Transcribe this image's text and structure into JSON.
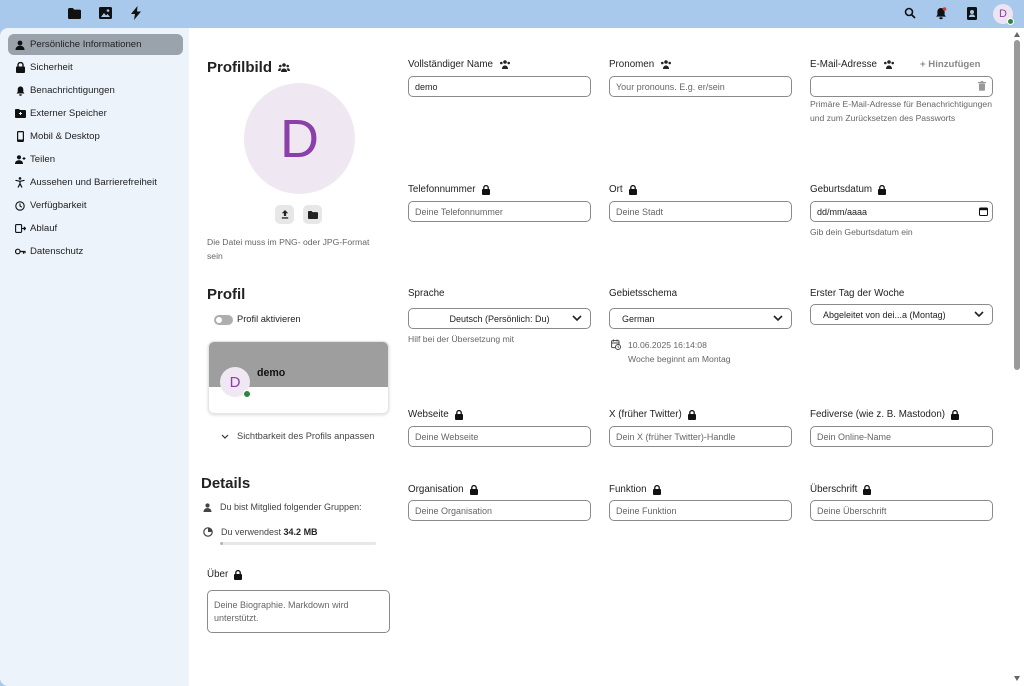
{
  "topbar": {
    "apps": [
      {
        "name": "files-icon"
      },
      {
        "name": "photos-icon"
      },
      {
        "name": "activity-icon"
      }
    ],
    "right_icons": [
      "search-icon",
      "notifications-icon",
      "contacts-icon"
    ],
    "avatar_letter": "D"
  },
  "sidebar": {
    "items": [
      {
        "label": "Persönliche Informationen",
        "icon": "user-icon",
        "active": true
      },
      {
        "label": "Sicherheit",
        "icon": "lock-icon"
      },
      {
        "label": "Benachrichtigungen",
        "icon": "bell-icon"
      },
      {
        "label": "Externer Speicher",
        "icon": "external-storage-icon"
      },
      {
        "label": "Mobil & Desktop",
        "icon": "phone-icon"
      },
      {
        "label": "Teilen",
        "icon": "share-icon"
      },
      {
        "label": "Aussehen und Barrierefreiheit",
        "icon": "accessibility-icon"
      },
      {
        "label": "Verfügbarkeit",
        "icon": "clock-icon"
      },
      {
        "label": "Ablauf",
        "icon": "flow-icon"
      },
      {
        "label": "Datenschutz",
        "icon": "key-icon"
      }
    ]
  },
  "profile_picture": {
    "title": "Profilbild",
    "letter": "D",
    "hint": "Die Datei muss im PNG- oder JPG-Format sein"
  },
  "profile": {
    "title": "Profil",
    "toggle_label": "Profil aktivieren",
    "card_name": "demo",
    "card_letter": "D",
    "visibility_label": "Sichtbarkeit des Profils anpassen"
  },
  "details": {
    "title": "Details",
    "groups_label": "Du bist Mitglied folgender Gruppen:",
    "quota_prefix": "Du verwendest",
    "quota_value": "34.2 MB",
    "quota_fraction": 0.02
  },
  "about": {
    "label": "Über",
    "placeholder": "Deine Biographie. Markdown wird unterstützt."
  },
  "fields": {
    "full_name": {
      "label": "Vollständiger Name",
      "value": "demo"
    },
    "pronouns": {
      "label": "Pronomen",
      "placeholder": "Your pronouns. E.g. er/sein"
    },
    "email": {
      "label": "E-Mail-Adresse",
      "add_label": "+ Hinzufügen",
      "hint": "Primäre E-Mail-Adresse für Benachrichtigungen und zum Zurücksetzen des Passworts"
    },
    "phone": {
      "label": "Telefonnummer",
      "placeholder": "Deine Telefonnummer"
    },
    "location": {
      "label": "Ort",
      "placeholder": "Deine Stadt"
    },
    "birthdate": {
      "label": "Geburtsdatum",
      "placeholder": "dd/mm/aaaa",
      "hint": "Gib dein Geburtsdatum ein"
    },
    "language": {
      "label": "Sprache",
      "value": "Deutsch (Persönlich: Du)",
      "hint": "Hilf bei der Übersetzung mit"
    },
    "locale": {
      "label": "Gebietsschema",
      "value": "German",
      "datetime": "10.06.2025 16:14:08",
      "week_start_hint": "Woche beginnt am Montag"
    },
    "first_day": {
      "label": "Erster Tag der Woche",
      "value": "Abgeleitet von dei...a (Montag)"
    },
    "website": {
      "label": "Webseite",
      "placeholder": "Deine Webseite"
    },
    "twitter": {
      "label": "X (früher Twitter)",
      "placeholder": "Dein X (früher Twitter)-Handle"
    },
    "fediverse": {
      "label": "Fediverse (wie z. B. Mastodon)",
      "placeholder": "Dein Online-Name"
    },
    "organisation": {
      "label": "Organisation",
      "placeholder": "Deine Organisation"
    },
    "role": {
      "label": "Funktion",
      "placeholder": "Deine Funktion"
    },
    "headline": {
      "label": "Überschrift",
      "placeholder": "Deine Überschrift"
    }
  },
  "colors": {
    "topbar": "#a8c8ec",
    "sidebar": "#edf3fb",
    "active_item": "#9aa2ab",
    "avatar_text": "#8b3fa8",
    "status_online": "#2e8540"
  }
}
